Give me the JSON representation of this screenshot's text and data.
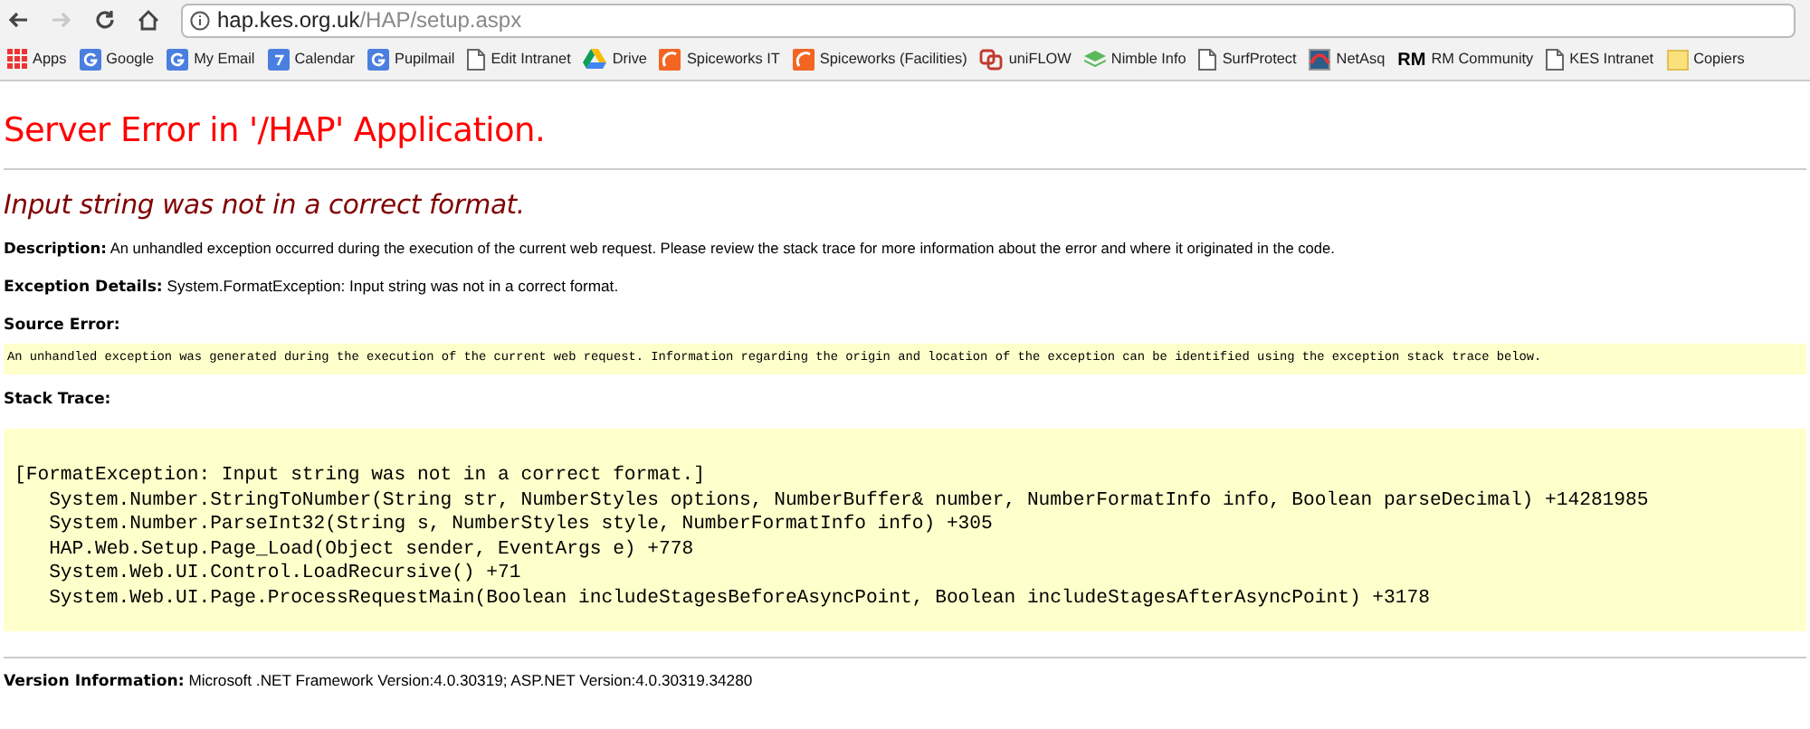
{
  "browser": {
    "back_disabled": false,
    "forward_disabled": true,
    "url_host": "hap.kes.org.uk",
    "url_path": "/HAP/setup.aspx"
  },
  "bookmarks": [
    {
      "kind": "apps",
      "label": "Apps"
    },
    {
      "kind": "google",
      "label": "Google"
    },
    {
      "kind": "google",
      "label": "My Email"
    },
    {
      "kind": "calendar",
      "label": "Calendar"
    },
    {
      "kind": "google",
      "label": "Pupilmail"
    },
    {
      "kind": "page",
      "label": "Edit Intranet"
    },
    {
      "kind": "drive",
      "label": "Drive"
    },
    {
      "kind": "spiceworks",
      "label": "Spiceworks IT"
    },
    {
      "kind": "spiceworks",
      "label": "Spiceworks (Facilities)"
    },
    {
      "kind": "uniflow",
      "label": "uniFLOW"
    },
    {
      "kind": "nimble",
      "label": "Nimble Info"
    },
    {
      "kind": "page",
      "label": "SurfProtect"
    },
    {
      "kind": "netasq",
      "label": "NetAsq"
    },
    {
      "kind": "rm",
      "logo": "RM",
      "label": "RM Community"
    },
    {
      "kind": "page",
      "label": "KES Intranet"
    },
    {
      "kind": "folder",
      "label": "Copiers"
    }
  ],
  "error_page": {
    "title": "Server Error in '/HAP' Application.",
    "message": "Input string was not in a correct format.",
    "description": {
      "label": "Description:",
      "text": "An unhandled exception occurred during the execution of the current web request. Please review the stack trace for more information about the error and where it originated in the code."
    },
    "exception_details": {
      "label": "Exception Details:",
      "text": "System.FormatException: Input string was not in a correct format."
    },
    "source_error": {
      "label": "Source Error:",
      "text": "An unhandled exception was generated during the execution of the current web request. Information regarding the origin and location of the exception can be identified using the exception stack trace below."
    },
    "stack_trace": {
      "label": "Stack Trace:",
      "lines": [
        "[FormatException: Input string was not in a correct format.]",
        "   System.Number.StringToNumber(String str, NumberStyles options, NumberBuffer& number, NumberFormatInfo info, Boolean parseDecimal) +14281985",
        "   System.Number.ParseInt32(String s, NumberStyles style, NumberFormatInfo info) +305",
        "   HAP.Web.Setup.Page_Load(Object sender, EventArgs e) +778",
        "   System.Web.UI.Control.LoadRecursive() +71",
        "   System.Web.UI.Page.ProcessRequestMain(Boolean includeStagesBeforeAsyncPoint, Boolean includeStagesAfterAsyncPoint) +3178"
      ]
    },
    "version_information": {
      "label": "Version Information:",
      "text": "Microsoft .NET Framework Version:4.0.30319; ASP.NET Version:4.0.30319.34280"
    }
  }
}
